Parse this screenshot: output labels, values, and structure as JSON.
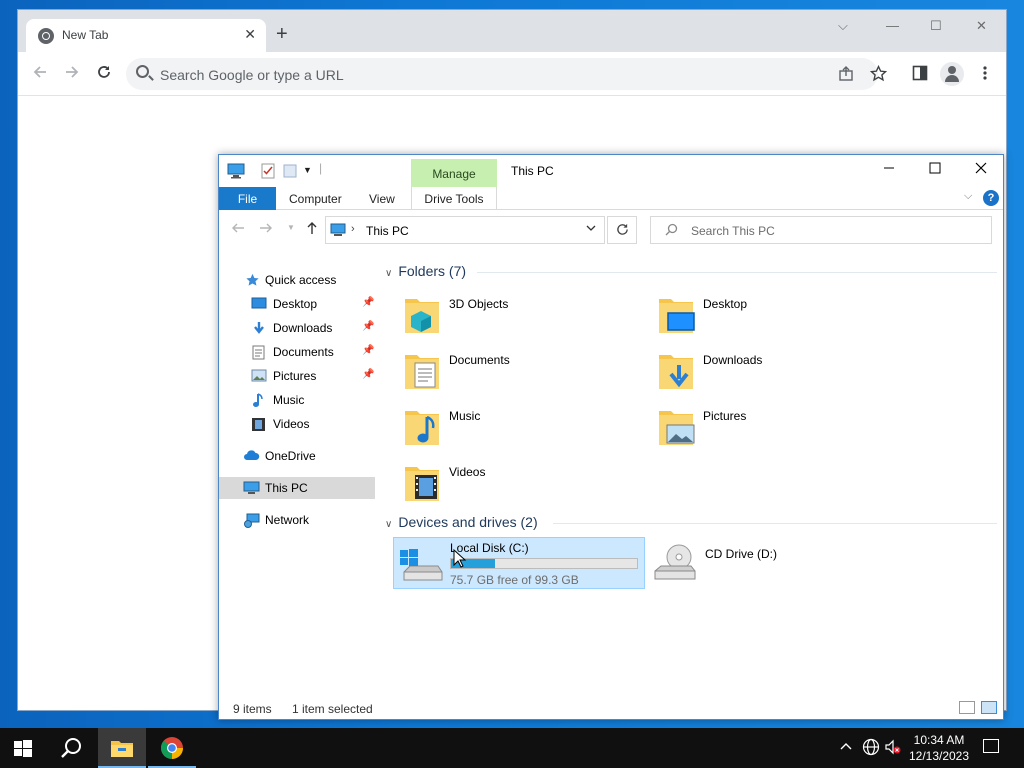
{
  "chrome": {
    "tab_title": "New Tab",
    "tab_close": "✕",
    "new_tab": "+",
    "omnibox_placeholder": "Search Google or type a URL",
    "controls": {
      "minimize_glyph": "—",
      "maximize_glyph": "☐",
      "close_glyph": "✕",
      "tabsearch_glyph": "⌵"
    }
  },
  "explorer": {
    "title": "This PC",
    "context_tab": "Manage",
    "ribbon": {
      "file": "File",
      "computer": "Computer",
      "view": "View",
      "drive_tools": "Drive Tools",
      "help": "?"
    },
    "address": {
      "path": "This PC",
      "sep": "›"
    },
    "search_placeholder": "Search This PC",
    "nav": {
      "quick_access": "Quick access",
      "desktop": "Desktop",
      "downloads": "Downloads",
      "documents": "Documents",
      "pictures": "Pictures",
      "music": "Music",
      "videos": "Videos",
      "onedrive": "OneDrive",
      "this_pc": "This PC",
      "network": "Network"
    },
    "folders_header": "Folders (7)",
    "folders": [
      "3D Objects",
      "Desktop",
      "Documents",
      "Downloads",
      "Music",
      "Pictures",
      "Videos"
    ],
    "drives_header": "Devices and drives (2)",
    "drives": {
      "c_label": "Local Disk (C:)",
      "c_free": "75.7 GB free of 99.3 GB",
      "c_used_fraction": 0.238,
      "d_label": "CD Drive (D:)"
    },
    "status": {
      "items": "9 items",
      "selected": "1 item selected"
    }
  },
  "taskbar": {
    "time": "10:34 AM",
    "date": "12/13/2023"
  },
  "colors": {
    "accent": "#1979ca",
    "selection": "#cce8ff",
    "manage_tab": "#c6efb0",
    "taskbar": "#101010",
    "drive_fill": "#26a0da"
  }
}
